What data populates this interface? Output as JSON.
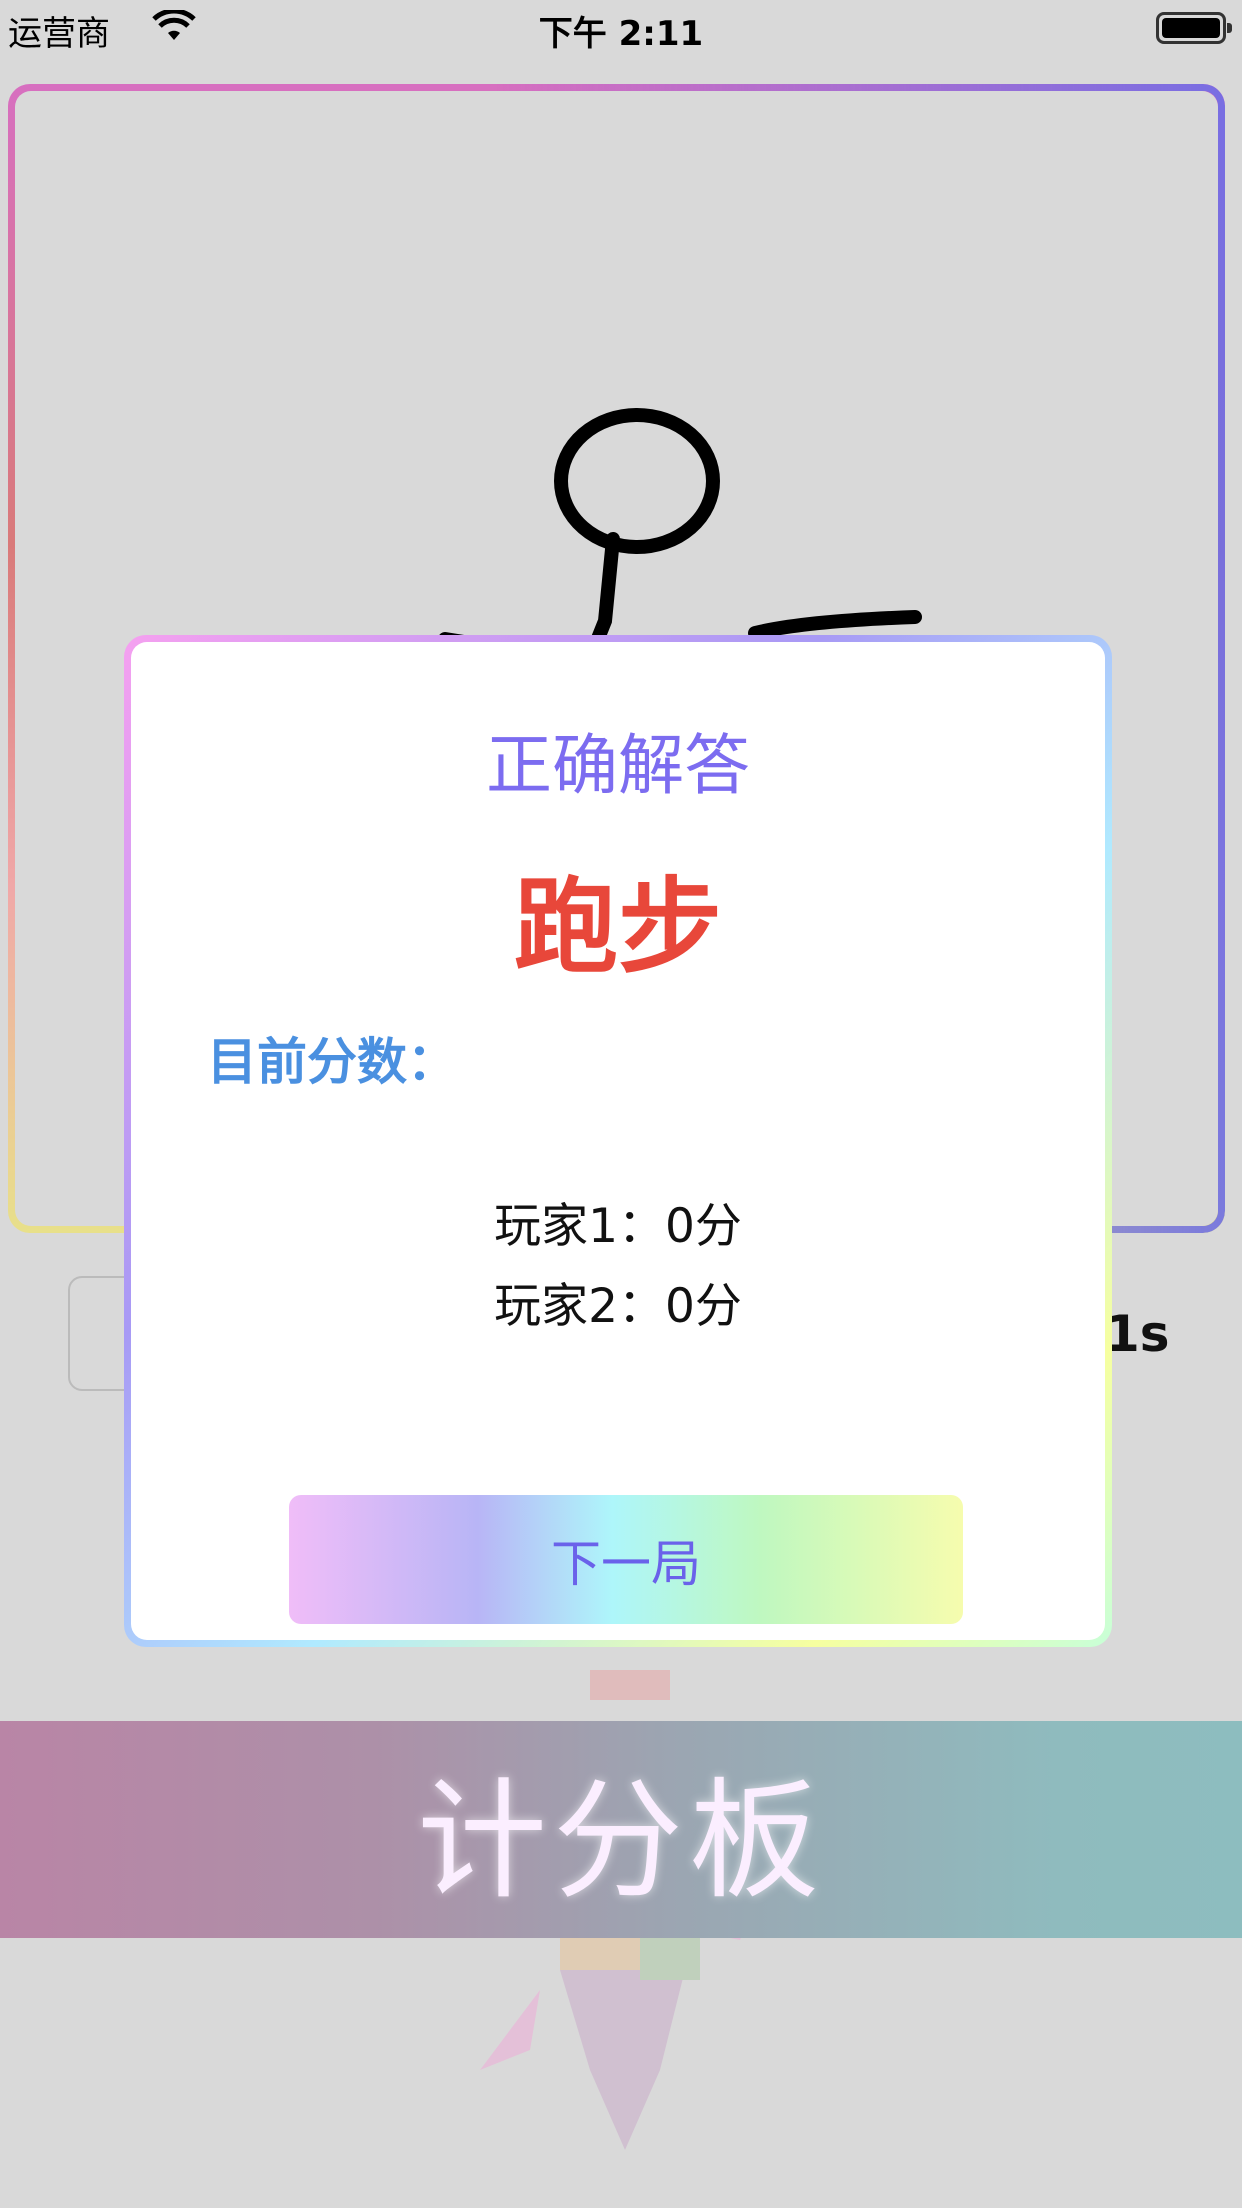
{
  "status_bar": {
    "carrier": "运营商",
    "time": "下午 2:11",
    "wifi_icon": "wifi-icon",
    "battery_icon": "battery-icon"
  },
  "game": {
    "timer": "1s"
  },
  "modal": {
    "title": "正确解答",
    "answer": "跑步",
    "score_label": "目前分数：",
    "scores": [
      "玩家1：0分",
      "玩家2：0分"
    ],
    "next_button": "下一局"
  },
  "banner": {
    "title": "计分板"
  },
  "colors": {
    "background": "#d9d9d9",
    "title": "#7c6cf0",
    "answer": "#e8473a",
    "label": "#4a90e0",
    "button_text": "#6a62ea"
  }
}
